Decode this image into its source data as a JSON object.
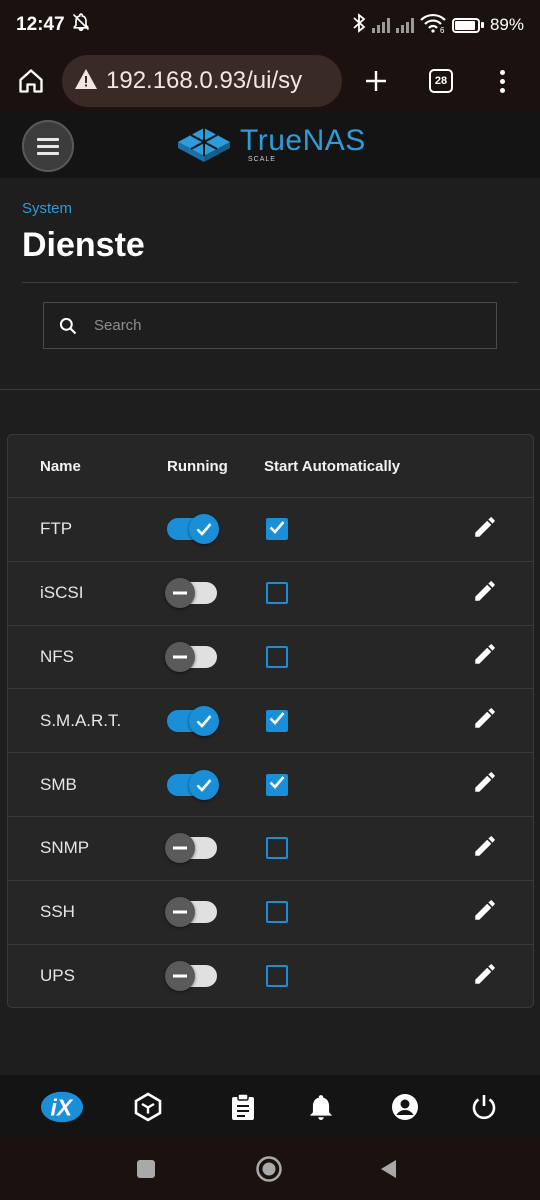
{
  "status_bar": {
    "time": "12:47",
    "battery": "89%",
    "wifi_badge": "6"
  },
  "browser": {
    "url": "192.168.0.93/ui/sy",
    "tab_count": "28"
  },
  "app": {
    "logo_name": "TrueNAS",
    "logo_sub": "SCALE"
  },
  "page": {
    "breadcrumb": "System",
    "title": "Dienste",
    "search_placeholder": "Search"
  },
  "table": {
    "headers": {
      "name": "Name",
      "running": "Running",
      "auto": "Start Automatically"
    },
    "rows": [
      {
        "name": "FTP",
        "running": true,
        "auto": true
      },
      {
        "name": "iSCSI",
        "running": false,
        "auto": false
      },
      {
        "name": "NFS",
        "running": false,
        "auto": false
      },
      {
        "name": "S.M.A.R.T.",
        "running": true,
        "auto": true
      },
      {
        "name": "SMB",
        "running": true,
        "auto": true
      },
      {
        "name": "SNMP",
        "running": false,
        "auto": false
      },
      {
        "name": "SSH",
        "running": false,
        "auto": false
      },
      {
        "name": "UPS",
        "running": false,
        "auto": false
      }
    ]
  },
  "colors": {
    "accent": "#1a8fd8",
    "brand": "#2d9cdb",
    "background": "#1e1e1e",
    "card": "#262626"
  },
  "bottom_nav": {
    "items": [
      "ix-systems-icon",
      "truecommand-icon",
      "jobs-clipboard-icon",
      "notifications-bell-icon",
      "account-icon",
      "power-icon"
    ]
  }
}
